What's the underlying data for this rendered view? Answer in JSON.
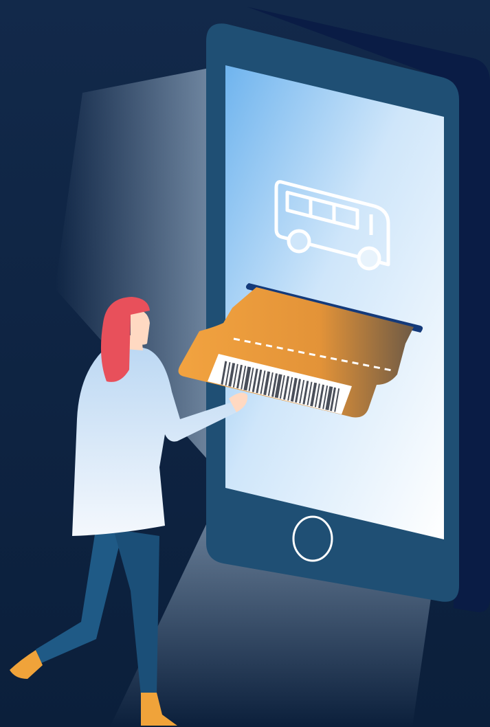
{
  "scene": {
    "description_name": "mobile-ticket-illustration",
    "colors": {
      "background": "#0d2240",
      "background_top": "#12294a",
      "phone_body": "#1f4f74",
      "phone_side": "#0a1c45",
      "screen_top": "#6fb4ee",
      "screen_bottom": "#ffffff",
      "ticket_left": "#f2a340",
      "ticket_right": "#7a5a3a",
      "slot": "#143a7a",
      "hair": "#e8505b",
      "skin": "#ffd9c2",
      "coat": "#e9f2fb",
      "pants": "#1f5a86",
      "shoes": "#f0a33a"
    },
    "icons": {
      "screen_icon": "bus-icon",
      "home_button": "home-button-icon",
      "ticket_code": "barcode-icon"
    }
  }
}
